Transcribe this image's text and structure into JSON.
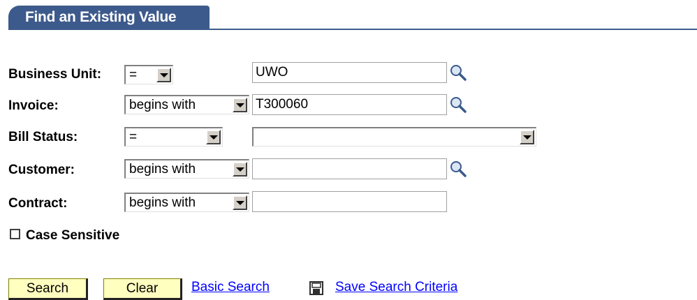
{
  "tab": {
    "title": "Find an Existing Value"
  },
  "fields": [
    {
      "label": "Business Unit:",
      "operator": "=",
      "value": "UWO",
      "has_lookup": true
    },
    {
      "label": "Invoice:",
      "operator": "begins with",
      "value": "T300060",
      "has_lookup": true
    },
    {
      "label": "Bill Status:",
      "operator": "=",
      "value": "",
      "has_lookup": false
    },
    {
      "label": "Customer:",
      "operator": "begins with",
      "value": "",
      "has_lookup": true
    },
    {
      "label": "Contract:",
      "operator": "begins with",
      "value": "",
      "has_lookup": false
    }
  ],
  "case_sensitive": {
    "label": "Case Sensitive",
    "checked": false
  },
  "actions": {
    "search": "Search",
    "clear": "Clear",
    "basic_search": "Basic Search",
    "save_search": "Save Search Criteria"
  },
  "icons": {
    "lookup": "magnifier-icon",
    "save": "floppy-disk-icon"
  },
  "colors": {
    "tab": "#3d5a8c",
    "button": "#ffffc0",
    "link": "#0000ff"
  }
}
